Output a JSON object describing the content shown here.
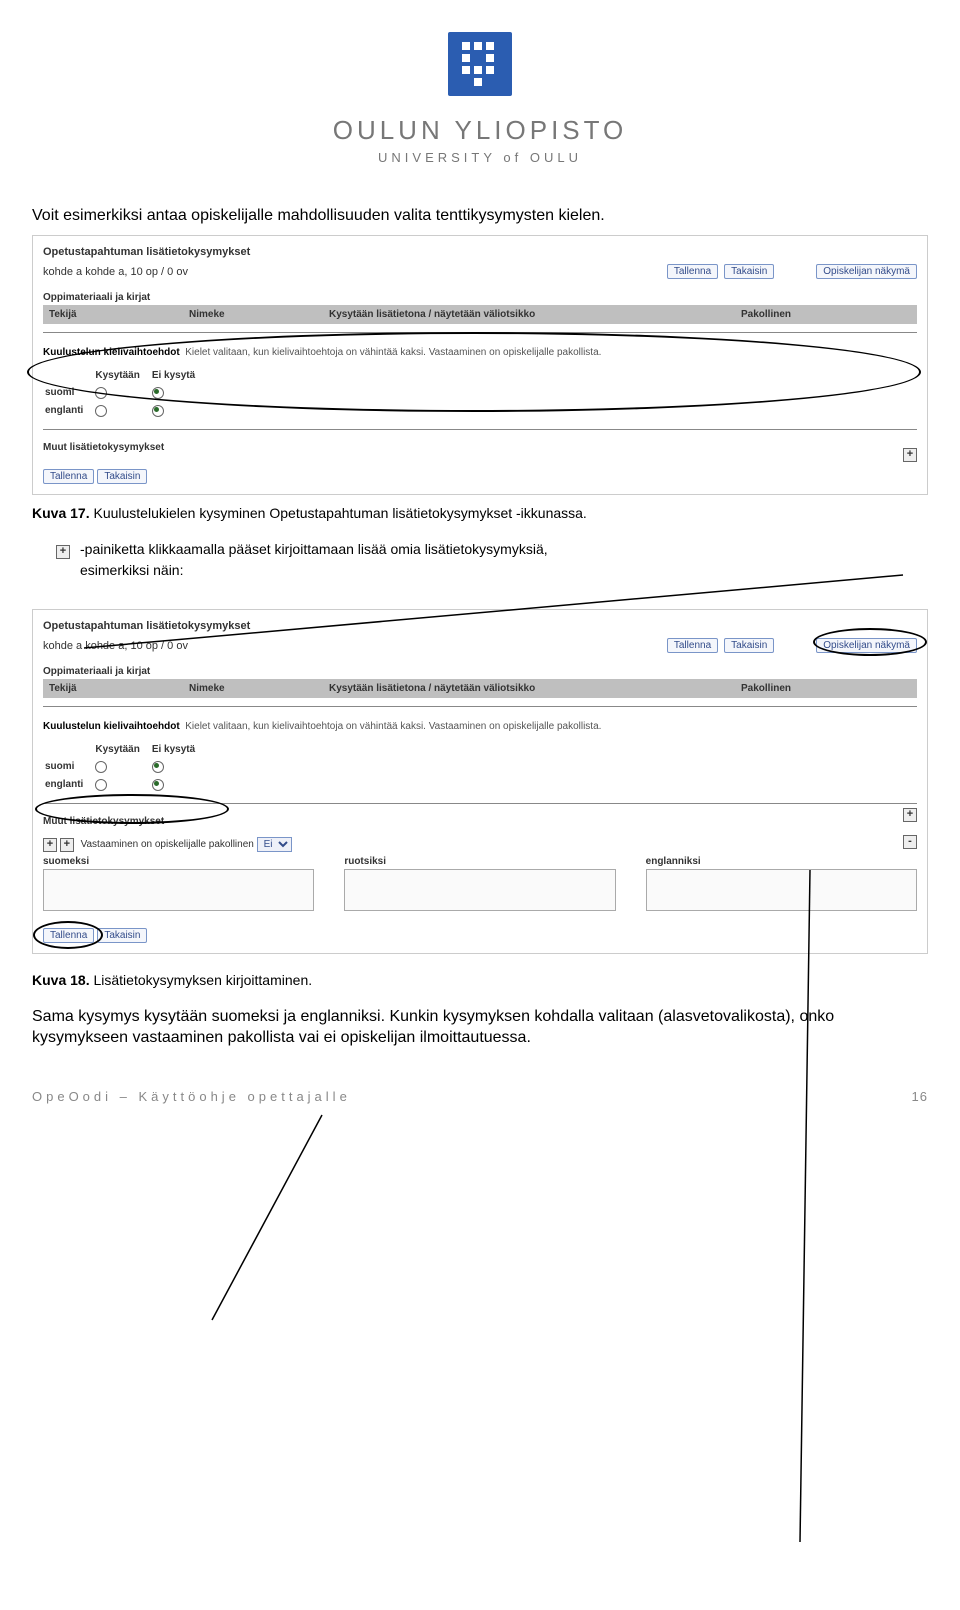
{
  "header": {
    "title": "OULUN YLIOPISTO",
    "subtitle": "UNIVERSITY of OULU"
  },
  "intro": {
    "line1": "Voit esimerkiksi antaa opiskelijalle mahdollisuuden valita tenttikysymysten kielen."
  },
  "shot1": {
    "heading": "Opetustapahtuman lisätietokysymykset",
    "sub": "kohde a kohde a, 10 op / 0 ov",
    "btn_tallenna": "Tallenna",
    "btn_takaisin": "Takaisin",
    "btn_opiskelijan": "Opiskelijan näkymä",
    "section_oppimateriaali": "Oppimateriaali ja kirjat",
    "th_tekija": "Tekijä",
    "th_nimeke": "Nimeke",
    "th_kys": "Kysytään lisätietona / näytetään väliotsikko",
    "th_pak": "Pakollinen",
    "kuulu_label": "Kuulustelun kielivaihtoehdot",
    "kuulu_note": "Kielet valitaan, kun kielivaihtoehtoja on vähintää kaksi. Vastaaminen on opiskelijalle pakollista.",
    "hdr_kysytaan": "Kysytään",
    "hdr_eikysyta": "Ei kysytä",
    "lang_suomi": "suomi",
    "lang_englanti": "englanti",
    "section_muut": "Muut lisätietokysymykset",
    "plus": "+"
  },
  "caption17": {
    "label": "Kuva 17.",
    "text": " Kuulustelukielen kysyminen Opetustapahtuman lisätietokysymykset -ikkunassa."
  },
  "plus_para": {
    "plus": "+",
    "line1": "-painiketta klikkaamalla pääset kirjoittamaan lisää omia lisätietokysymyksiä,",
    "line2": "esimerkiksi näin:"
  },
  "shot2": {
    "heading": "Opetustapahtuman lisätietokysymykset",
    "sub": "kohde a kohde a, 10 op / 0 ov",
    "btn_tallenna": "Tallenna",
    "btn_takaisin": "Takaisin",
    "btn_opiskelijan": "Opiskelijan näkymä",
    "section_oppimateriaali": "Oppimateriaali ja kirjat",
    "th_tekija": "Tekijä",
    "th_nimeke": "Nimeke",
    "th_kys": "Kysytään lisätietona / näytetään väliotsikko",
    "th_pak": "Pakollinen",
    "kuulu_label": "Kuulustelun kielivaihtoehdot",
    "kuulu_note": "Kielet valitaan, kun kielivaihtoehtoja on vähintää kaksi. Vastaaminen on opiskelijalle pakollista.",
    "hdr_kysytaan": "Kysytään",
    "hdr_eikysyta": "Ei kysytä",
    "lang_suomi": "suomi",
    "lang_englanti": "englanti",
    "section_muut": "Muut lisätietokysymykset",
    "vast_line": "Vastaaminen on opiskelijalle pakollinen",
    "select_value": "Ei",
    "lbl_suomeksi": "suomeksi",
    "lbl_ruotsiksi": "ruotsiksi",
    "lbl_englanniksi": "englanniksi",
    "plus": "+",
    "minus": "-"
  },
  "caption18": {
    "label": "Kuva 18.",
    "text": " Lisätietokysymyksen kirjoittaminen."
  },
  "closing": {
    "text": "Sama kysymys kysytään suomeksi ja englanniksi. Kunkin kysymyksen kohdalla valitaan (alasvetovalikosta), onko kysymykseen vastaaminen pakollista vai ei opiskelijan ilmoittautuessa."
  },
  "footer": {
    "left": "OpeOodi – Käyttöohje opettajalle",
    "page": "16"
  }
}
